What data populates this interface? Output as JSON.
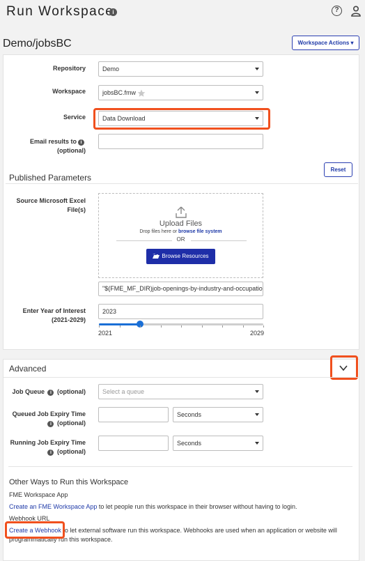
{
  "header": {
    "title": "Run Workspace",
    "info_icon": "info-icon",
    "help_icon": "help-circle-icon",
    "user_icon": "user-icon"
  },
  "workspace_path": "Demo/jobsBC",
  "workspace_actions_label": "Workspace Actions ▾",
  "form": {
    "repository": {
      "label": "Repository",
      "value": "Demo"
    },
    "workspace": {
      "label": "Workspace",
      "value": "jobsBC.fmw"
    },
    "service": {
      "label": "Service",
      "value": "Data Download"
    },
    "email": {
      "label": "Email results to",
      "sub": "(optional)",
      "value": ""
    }
  },
  "published_parameters": {
    "title": "Published Parameters",
    "reset_label": "Reset",
    "source": {
      "label_line1": "Source Microsoft Excel",
      "label_line2": "File(s)",
      "upload_title": "Upload Files",
      "hint_prefix": "Drop files here or ",
      "hint_link": "browse file system",
      "or": "OR",
      "browse_label": "Browse Resources",
      "path_value": "\"$(FME_MF_DIR)job-openings-by-industry-and-occupation-f"
    },
    "year": {
      "label_line1": "Enter Year of Interest",
      "label_line2": "(2021-2029)",
      "value": "2023",
      "min_label": "2021",
      "max_label": "2029",
      "min": 2021,
      "max": 2029,
      "current": 2023
    }
  },
  "advanced": {
    "title": "Advanced",
    "job_queue": {
      "label": "Job Queue",
      "sub": "(optional)",
      "placeholder": "Select a queue"
    },
    "queued_expiry": {
      "label": "Queued Job Expiry Time",
      "sub": "(optional)",
      "unit": "Seconds"
    },
    "running_expiry": {
      "label": "Running Job Expiry Time",
      "sub": "(optional)",
      "unit": "Seconds"
    }
  },
  "other_ways": {
    "title": "Other Ways to Run this Workspace",
    "app_heading": "FME Workspace App",
    "app_link": "Create an FME Workspace App",
    "app_text": " to let people run this workspace in their browser without having to login.",
    "webhook_heading": "Webhook URL",
    "webhook_link": "Create a Webhook",
    "webhook_text": " to let external software run this workspace. Webhooks are used when an application or website will",
    "webhook_text2": "programmatically run this workspace."
  },
  "colors": {
    "highlight": "#f0501e",
    "primary": "#1e2ea8",
    "slider": "#1a6fd6"
  }
}
